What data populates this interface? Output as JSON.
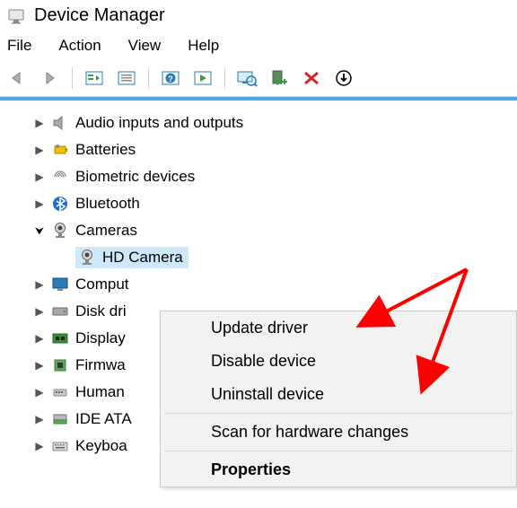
{
  "window": {
    "title": "Device Manager"
  },
  "menubar": [
    "File",
    "Action",
    "View",
    "Help"
  ],
  "toolbar": {
    "back": "back-icon",
    "forward": "forward-icon",
    "show_hidden": "show-hidden-icon",
    "refresh2": "list-icon",
    "help": "help-icon",
    "play": "play-icon",
    "scan": "monitor-scan-icon",
    "add": "add-hw-icon",
    "delete": "delete-icon",
    "more": "more-icon"
  },
  "tree": {
    "items": [
      {
        "label": "Audio inputs and outputs",
        "icon": "speaker",
        "expanded": false
      },
      {
        "label": "Batteries",
        "icon": "battery",
        "expanded": false
      },
      {
        "label": "Biometric devices",
        "icon": "biometric",
        "expanded": false
      },
      {
        "label": "Bluetooth",
        "icon": "bluetooth",
        "expanded": false
      },
      {
        "label": "Cameras",
        "icon": "camera",
        "expanded": true,
        "children": [
          {
            "label": "HD Camera",
            "icon": "camera",
            "selected": true
          }
        ]
      },
      {
        "label": "Comput",
        "icon": "monitor",
        "expanded": false
      },
      {
        "label": "Disk dri",
        "icon": "disk",
        "expanded": false
      },
      {
        "label": "Display",
        "icon": "gpu",
        "expanded": false
      },
      {
        "label": "Firmwa",
        "icon": "chip",
        "expanded": false
      },
      {
        "label": "Human",
        "icon": "hid",
        "expanded": false
      },
      {
        "label": "IDE ATA",
        "icon": "ide",
        "expanded": false
      },
      {
        "label": "Keyboa",
        "icon": "keyboard",
        "expanded": false
      }
    ]
  },
  "context_menu": {
    "items": [
      {
        "label": "Update driver",
        "bold": false
      },
      {
        "label": "Disable device",
        "bold": false
      },
      {
        "label": "Uninstall device",
        "bold": false
      },
      {
        "sep": true
      },
      {
        "label": "Scan for hardware changes",
        "bold": false
      },
      {
        "sep": true
      },
      {
        "label": "Properties",
        "bold": true
      }
    ]
  },
  "annotation": {
    "color": "#ff0000"
  }
}
